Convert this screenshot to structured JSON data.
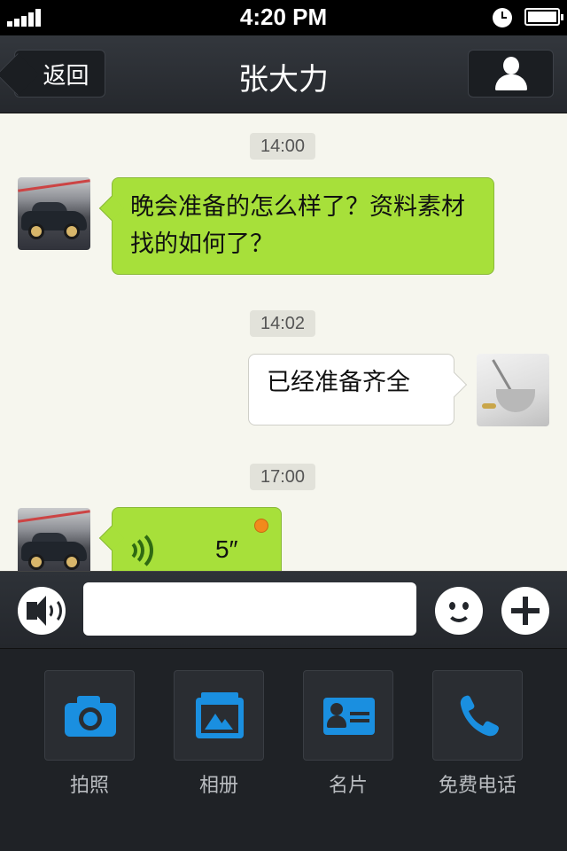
{
  "status_bar": {
    "time": "4:20 PM"
  },
  "nav": {
    "back_label": "返回",
    "title": "张大力"
  },
  "messages": [
    {
      "time": "14:00",
      "text": "晚会准备的怎么样了？资料素材找的如何了？"
    },
    {
      "time": "14:02",
      "text": "已经准备齐全"
    },
    {
      "time": "17:00",
      "voice_duration": "5″"
    }
  ],
  "input": {
    "value": ""
  },
  "attachments": [
    {
      "label": "拍照"
    },
    {
      "label": "相册"
    },
    {
      "label": "名片"
    },
    {
      "label": "免费电话"
    }
  ],
  "colors": {
    "incoming_bubble": "#a7e03a",
    "outgoing_bubble": "#ffffff",
    "chat_background": "#f6f6ee",
    "accent_icon": "#1a8fe0",
    "unread_dot": "#f28a1c"
  }
}
